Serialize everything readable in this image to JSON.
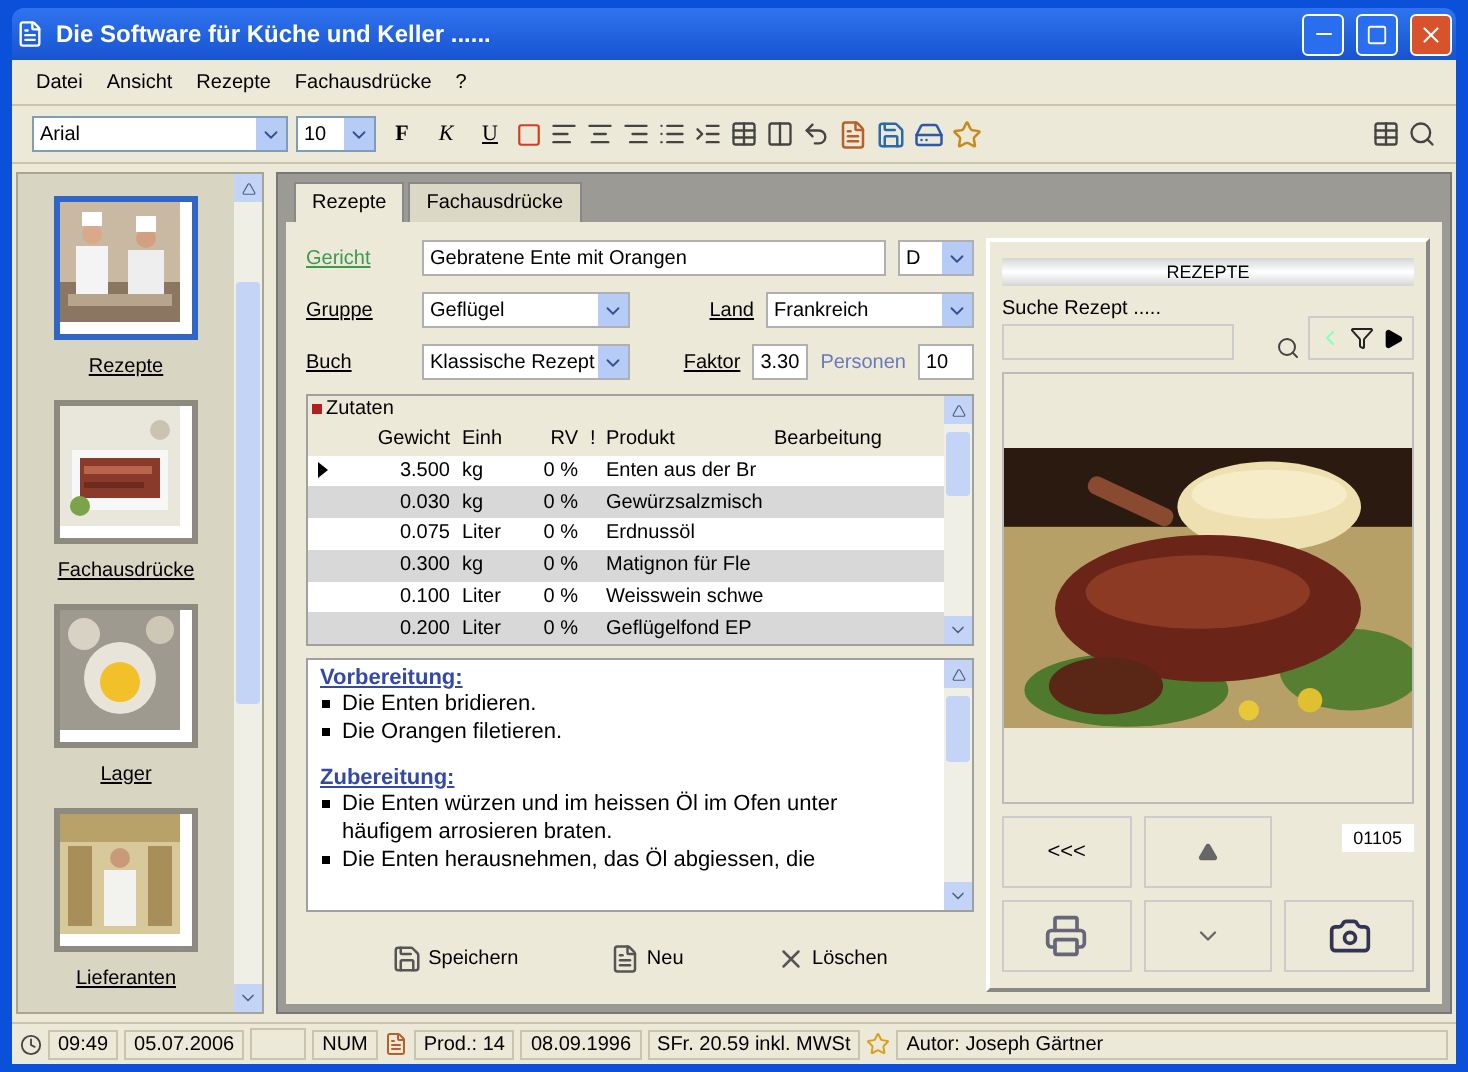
{
  "window": {
    "title": "Die Software für Küche und Keller ......"
  },
  "menu": [
    "Datei",
    "Ansicht",
    "Rezepte",
    "Fachausdrücke",
    "?"
  ],
  "toolbar": {
    "font": "Arial",
    "size": "10",
    "format_buttons": [
      {
        "label": "F",
        "kind": "bold"
      },
      {
        "label": "K",
        "kind": "italic"
      },
      {
        "label": "U",
        "kind": "underline"
      }
    ]
  },
  "sidebar": {
    "items": [
      {
        "label": "Rezepte",
        "selected": true
      },
      {
        "label": "Fachausdrücke",
        "selected": false
      },
      {
        "label": "Lager",
        "selected": false
      },
      {
        "label": "Lieferanten",
        "selected": false
      }
    ]
  },
  "tabs": [
    {
      "label": "Rezepte",
      "selected": true
    },
    {
      "label": "Fachausdrücke",
      "selected": false
    }
  ],
  "form": {
    "gericht": {
      "label": "Gericht",
      "value": "Gebratene Ente mit Orangen",
      "code": "D"
    },
    "gruppe": {
      "label": "Gruppe",
      "value": "Geflügel"
    },
    "land": {
      "label": "Land",
      "value": "Frankreich"
    },
    "buch": {
      "label": "Buch",
      "value": "Klassische Rezept"
    },
    "faktor": {
      "label": "Faktor",
      "value": "3.30"
    },
    "personen": {
      "label": "Personen",
      "value": "10"
    }
  },
  "ingredients": {
    "title": "Zutaten",
    "columns": [
      "Gewicht",
      "Einh",
      "RV",
      "!",
      "Produkt",
      "Bearbeitung"
    ],
    "rows": [
      {
        "gewicht": "3.500",
        "einh": "kg",
        "rv": "0 %",
        "produkt": "Enten aus der Br",
        "selected": true
      },
      {
        "gewicht": "0.030",
        "einh": "kg",
        "rv": "0 %",
        "produkt": "Gewürzsalzmisch",
        "selected": false
      },
      {
        "gewicht": "0.075",
        "einh": "Liter",
        "rv": "0 %",
        "produkt": "Erdnussöl",
        "selected": false
      },
      {
        "gewicht": "0.300",
        "einh": "kg",
        "rv": "0 %",
        "produkt": "Matignon für Fle",
        "selected": false
      },
      {
        "gewicht": "0.100",
        "einh": "Liter",
        "rv": "0 %",
        "produkt": "Weisswein schwe",
        "selected": false
      },
      {
        "gewicht": "0.200",
        "einh": "Liter",
        "rv": "0 %",
        "produkt": "Geflügelfond EP",
        "selected": false
      }
    ]
  },
  "instructions": [
    {
      "kind": "heading",
      "text": "Vorbereitung:"
    },
    {
      "kind": "bullet",
      "text": "Die Enten bridieren."
    },
    {
      "kind": "bullet",
      "text": "Die Orangen filetieren."
    },
    {
      "kind": "gap"
    },
    {
      "kind": "heading",
      "text": "Zubereitung:"
    },
    {
      "kind": "bullet",
      "text": "Die Enten würzen und im heissen Öl im Ofen unter häufigem arrosieren braten."
    },
    {
      "kind": "bullet",
      "text": "Die Enten herausnehmen, das Öl abgiessen, die"
    }
  ],
  "actions": [
    "Speichern",
    "Neu",
    "Löschen"
  ],
  "recipe_panel": {
    "title": "REZEPTE",
    "search_label": "Suche Rezept .....",
    "first_button": "<<<",
    "counter": "01105"
  },
  "status_bar": {
    "time": "09:49",
    "date": "05.07.2006",
    "num": "NUM",
    "prod": "Prod.: 14",
    "changed": "08.09.1996",
    "price": "SFr. 20.59 inkl. MWSt",
    "author": "Autor: Joseph Gärtner"
  }
}
